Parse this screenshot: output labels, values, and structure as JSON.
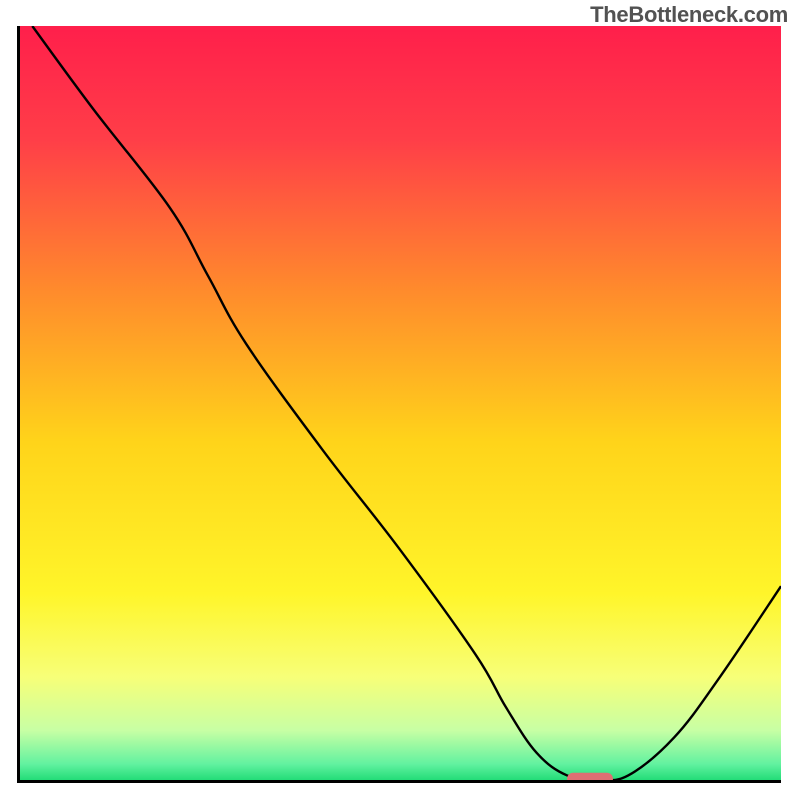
{
  "watermark": "TheBottleneck.com",
  "chart_data": {
    "type": "line",
    "title": "",
    "xlabel": "",
    "ylabel": "",
    "xlim": [
      0,
      100
    ],
    "ylim": [
      0,
      100
    ],
    "series": [
      {
        "name": "curve",
        "x": [
          2,
          10,
          20,
          25,
          30,
          40,
          50,
          60,
          64,
          68,
          72,
          76,
          80,
          86,
          92,
          100
        ],
        "y": [
          100,
          89,
          76,
          67,
          58,
          44,
          31,
          17,
          10,
          4,
          1,
          0.5,
          1,
          6,
          14,
          26
        ]
      }
    ],
    "marker": {
      "x": 75,
      "y": 0.5,
      "width_pct": 6,
      "color": "#de6f73"
    },
    "background_gradient": {
      "stops": [
        {
          "offset": 0.0,
          "color": "#ff1f4b"
        },
        {
          "offset": 0.15,
          "color": "#ff3e48"
        },
        {
          "offset": 0.35,
          "color": "#ff8b2c"
        },
        {
          "offset": 0.55,
          "color": "#ffd41a"
        },
        {
          "offset": 0.75,
          "color": "#fff52a"
        },
        {
          "offset": 0.86,
          "color": "#f7ff78"
        },
        {
          "offset": 0.93,
          "color": "#c8ffa4"
        },
        {
          "offset": 0.975,
          "color": "#62f2a0"
        },
        {
          "offset": 1.0,
          "color": "#17d870"
        }
      ]
    }
  }
}
